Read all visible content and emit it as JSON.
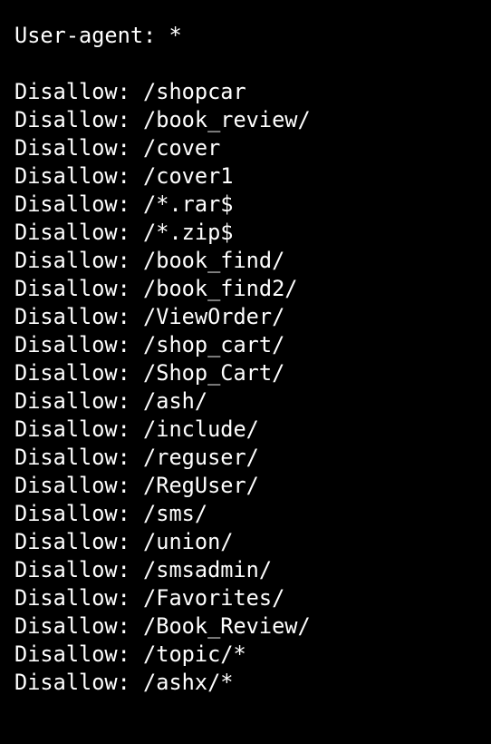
{
  "user_agent_line": "User-agent: *",
  "disallow_lines": [
    "Disallow: /shopcar",
    "Disallow: /book_review/",
    "Disallow: /cover",
    "Disallow: /cover1",
    "Disallow: /*.rar$",
    "Disallow: /*.zip$",
    "Disallow: /book_find/",
    "Disallow: /book_find2/",
    "Disallow: /ViewOrder/",
    "Disallow: /shop_cart/",
    "Disallow: /Shop_Cart/",
    "Disallow: /ash/",
    "Disallow: /include/",
    "Disallow: /reguser/",
    "Disallow: /RegUser/",
    "Disallow: /sms/",
    "Disallow: /union/",
    "Disallow: /smsadmin/",
    "Disallow: /Favorites/",
    "Disallow: /Book_Review/",
    "Disallow: /topic/*",
    "Disallow: /ashx/*"
  ],
  "colors": {
    "background": "#000000",
    "text": "#ffffff"
  }
}
